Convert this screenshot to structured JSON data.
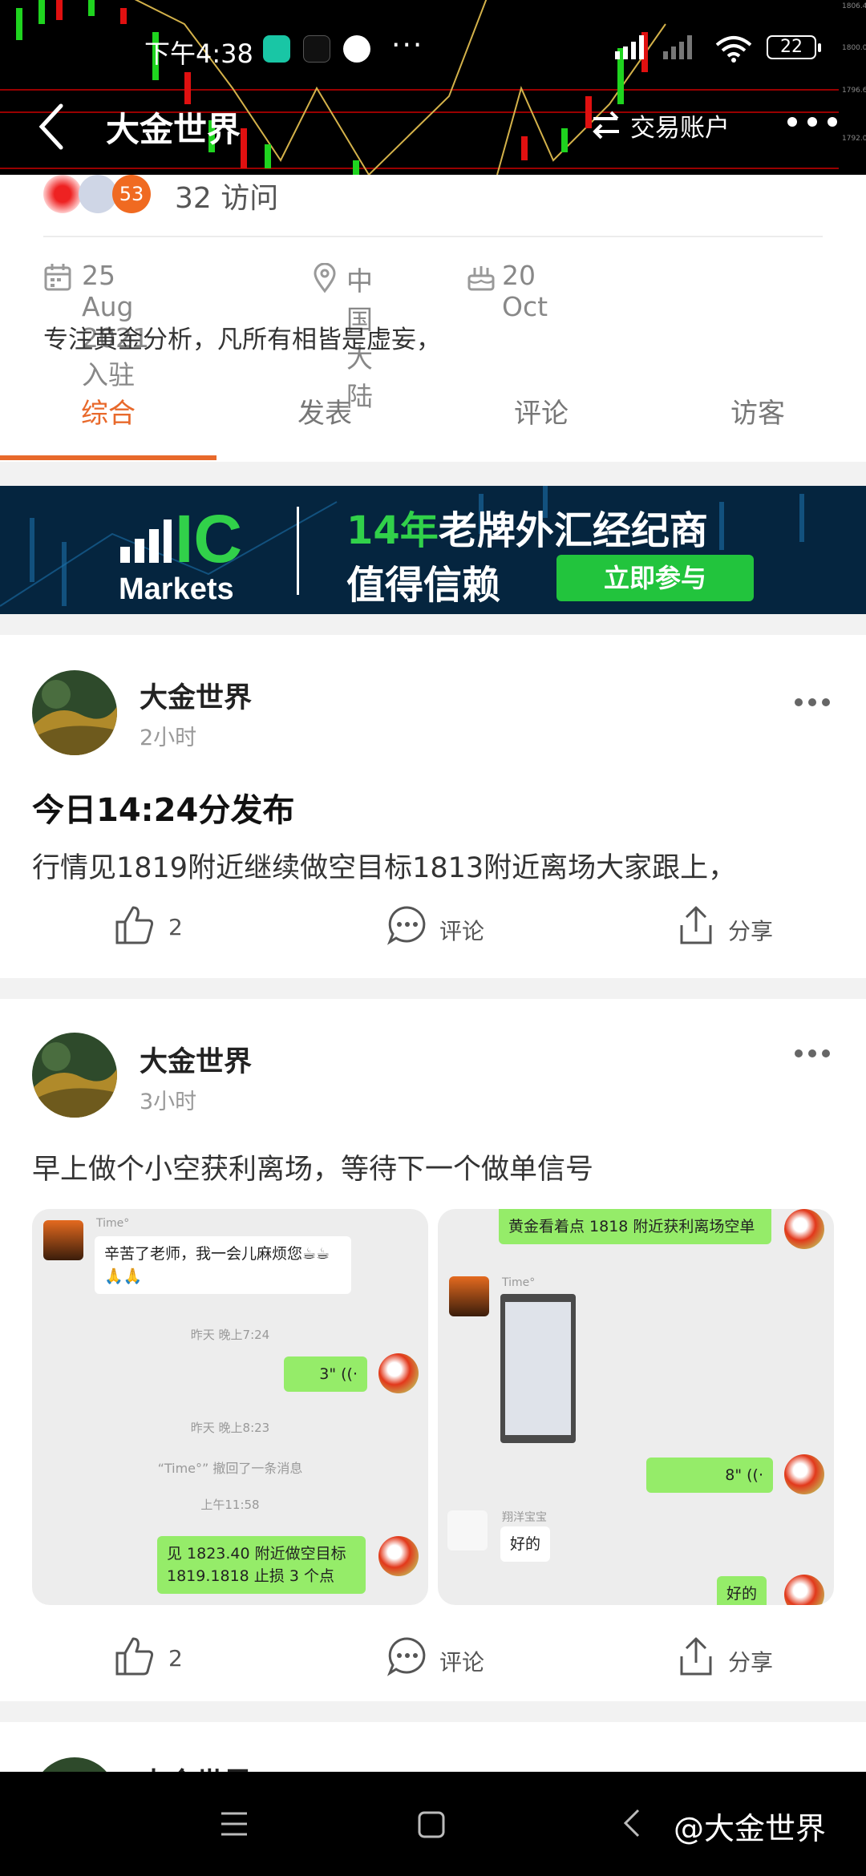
{
  "status_bar": {
    "time": "下午4:38",
    "more": "···",
    "battery": "22"
  },
  "navbar": {
    "title": "大金世界",
    "trade_account": "交易账户"
  },
  "profile": {
    "badge": "53",
    "visits": "32 访问",
    "joined": "25 Aug 2021 入驻",
    "location": "中国大陆",
    "birthday": "20 Oct",
    "bio": "专注黄金分析，凡所有相皆是虚妄，"
  },
  "tabs": [
    {
      "label": "综合",
      "active": true
    },
    {
      "label": "发表",
      "active": false
    },
    {
      "label": "评论",
      "active": false
    },
    {
      "label": "访客",
      "active": false
    }
  ],
  "banner": {
    "logo_ic": "IC",
    "logo_markets": "Markets",
    "line1_highlight": "14年",
    "line1_rest": "老牌外汇经纪商",
    "line2": "值得信赖",
    "cta": "立即参与"
  },
  "posts": [
    {
      "author": "大金世界",
      "time": "2小时",
      "heading": "今日14:24分发布",
      "text": "行情见1819附近继续做空目标1813附近离场大家跟上，",
      "likes": "2",
      "comment_label": "评论",
      "share_label": "分享"
    },
    {
      "author": "大金世界",
      "time": "3小时",
      "text": "早上做个小空获利离场，等待下一个做单信号",
      "likes": "2",
      "comment_label": "评论",
      "share_label": "分享",
      "chat_left": {
        "sender_name": "Time°",
        "msg1": "辛苦了老师，我一会儿麻烦您☕☕🙏🙏",
        "stamp1": "昨天 晚上7:24",
        "voice1": "3\" ((·",
        "stamp2": "昨天 晚上8:23",
        "recall": "“Time°” 撤回了一条消息",
        "stamp3": "上午11:58",
        "msg2": "见 1823.40 附近做空目标 1819.1818 止损 3 个点"
      },
      "chat_right": {
        "msg1": "黄金看着点 1818 附近获利离场空单",
        "sender_name": "Time°",
        "voice1": "8\" ((·",
        "sender2": "翔洋宝宝",
        "msg2": "好的",
        "msg3": "好的"
      }
    },
    {
      "author": "大金世界"
    }
  ],
  "watermark": "@大金世界"
}
